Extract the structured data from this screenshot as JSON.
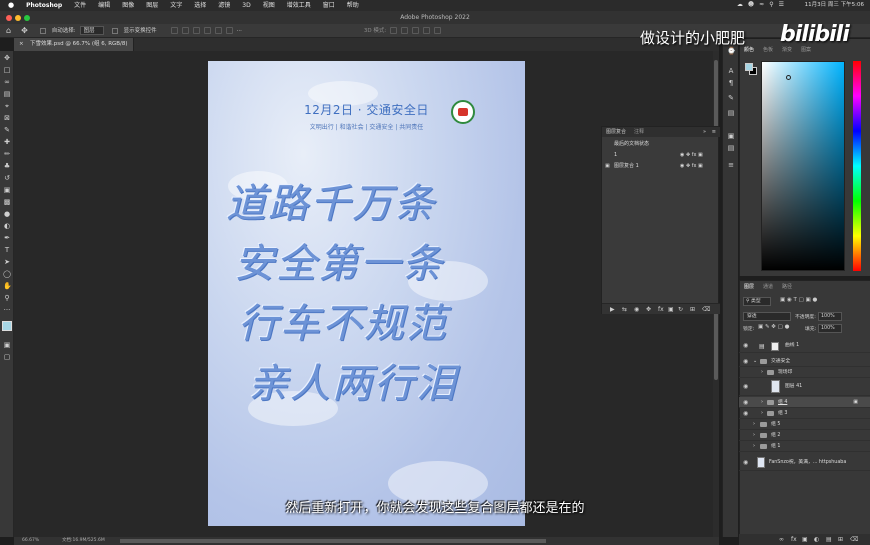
{
  "menubar": {
    "apple": "",
    "app": "Photoshop",
    "items": [
      "文件",
      "编辑",
      "图像",
      "图层",
      "文字",
      "选择",
      "滤镜",
      "3D",
      "视图",
      "增效工具",
      "窗口",
      "帮助"
    ],
    "clock": "11月3日 周三 下午5:06"
  },
  "window": {
    "title": "Adobe Photoshop 2022"
  },
  "options": {
    "auto_select_label": "自动选择:",
    "auto_select_value": "图层",
    "transform_label": "显示变换控件",
    "threed_label": "3D 模式:"
  },
  "document": {
    "tab": "下雪效果.psd @ 66.7% (组 6, RGB/8)",
    "zoom": "66.67%",
    "doc_size": "文档:16.9M/525.6M"
  },
  "artwork": {
    "title": "12月2日 · 交通安全日",
    "subtitle": "文明出行 | 和谐社会 | 交通安全 | 共同责任",
    "lines": [
      "道路千万条",
      "安全第一条",
      "行车不规范",
      "亲人两行泪"
    ]
  },
  "caption": "然后重新打开，你就会发现这些复合图层都还是在的",
  "watermark": {
    "text": "做设计的小肥肥",
    "logo": "bilibili"
  },
  "history": {
    "tabs": [
      "图层复合",
      "注释"
    ],
    "rows": [
      "最后的文档状态",
      "1",
      "图层复合 1"
    ]
  },
  "color_panel": {
    "tabs": [
      "颜色",
      "色板",
      "渐变",
      "图案"
    ],
    "foreground": "#a6d5e4",
    "background": "#000000"
  },
  "layers_panel": {
    "tabs": [
      "图层",
      "通道",
      "路径"
    ],
    "kind_label": "类型",
    "blend_mode": "穿透",
    "opacity_label": "不透明度:",
    "opacity": "100%",
    "lock_label": "锁定:",
    "fill_label": "填充:",
    "fill": "100%",
    "layers": [
      {
        "name": "曲线 1",
        "type": "adjustment",
        "indent": 0
      },
      {
        "name": "交通安全",
        "type": "group",
        "indent": 0
      },
      {
        "name": "现场印",
        "type": "group",
        "indent": 1
      },
      {
        "name": "图层 41",
        "type": "layer",
        "indent": 1
      },
      {
        "name": "组 4",
        "type": "group",
        "indent": 1
      },
      {
        "name": "组 3",
        "type": "group",
        "indent": 1
      },
      {
        "name": "组 5",
        "type": "group",
        "indent": 1
      },
      {
        "name": "组 2",
        "type": "group",
        "indent": 1
      },
      {
        "name": "组 1",
        "type": "group",
        "indent": 1
      },
      {
        "name": "FanSnzo祝，美满，...  httpshuaba",
        "type": "layer",
        "indent": 0
      }
    ]
  }
}
